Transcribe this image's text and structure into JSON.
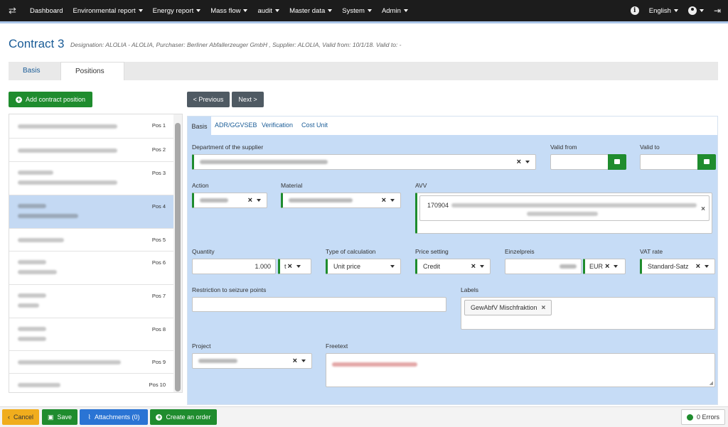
{
  "nav": {
    "items": [
      {
        "label": "Dashboard",
        "dropdown": false
      },
      {
        "label": "Environmental report",
        "dropdown": true
      },
      {
        "label": "Energy report",
        "dropdown": true
      },
      {
        "label": "Mass flow",
        "dropdown": true
      },
      {
        "label": "audit",
        "dropdown": true
      },
      {
        "label": "Master data",
        "dropdown": true
      },
      {
        "label": "System",
        "dropdown": true
      },
      {
        "label": "Admin",
        "dropdown": true
      }
    ],
    "language": "English"
  },
  "header": {
    "title": "Contract 3",
    "subtitle": "Designation: ALOLIA - ALOLIA, Purchaser: Berliner Abfallerzeuger GmbH , Supplier: ALOLIA, Valid from: 10/1/18. Valid to: -"
  },
  "main_tabs": [
    "Basis",
    "Positions"
  ],
  "buttons": {
    "add_position": "Add contract position",
    "previous": "< Previous",
    "next": "Next >"
  },
  "positions": [
    "Pos 1",
    "Pos 2",
    "Pos 3",
    "Pos 4",
    "Pos 5",
    "Pos 6",
    "Pos 7",
    "Pos 8",
    "Pos 9",
    "Pos 10"
  ],
  "sub_tabs": [
    "Basis",
    "ADR/GGVSEB",
    "Verification",
    "Cost Unit"
  ],
  "form": {
    "department_label": "Department of the supplier",
    "valid_from_label": "Valid from",
    "valid_to_label": "Valid to",
    "action_label": "Action",
    "material_label": "Material",
    "avv_label": "AVV",
    "avv_code": "170904",
    "quantity_label": "Quantity",
    "quantity_value": "1.000",
    "quantity_unit": "t",
    "calc_type_label": "Type of calculation",
    "calc_type_value": "Unit price",
    "price_setting_label": "Price setting",
    "price_setting_value": "Credit",
    "unit_price_label": "Einzelpreis",
    "currency_value": "EUR",
    "vat_label": "VAT rate",
    "vat_value": "Standard-Satz",
    "restriction_label": "Restriction to seizure points",
    "labels_label": "Labels",
    "label_chip": "GewAbfV Mischfraktion",
    "project_label": "Project",
    "freetext_label": "Freetext"
  },
  "footer": {
    "cancel": "Cancel",
    "save": "Save",
    "attachments": "Attachments (0)",
    "create_order": "Create an order",
    "errors": "0 Errors"
  },
  "colors": {
    "navbar": "#1c1c1c",
    "primary_green": "#1f8c2e",
    "panel_blue": "#c6dcf6",
    "link_blue": "#1a5c97",
    "warning": "#f0ad1d",
    "info_blue": "#2a74d4"
  }
}
